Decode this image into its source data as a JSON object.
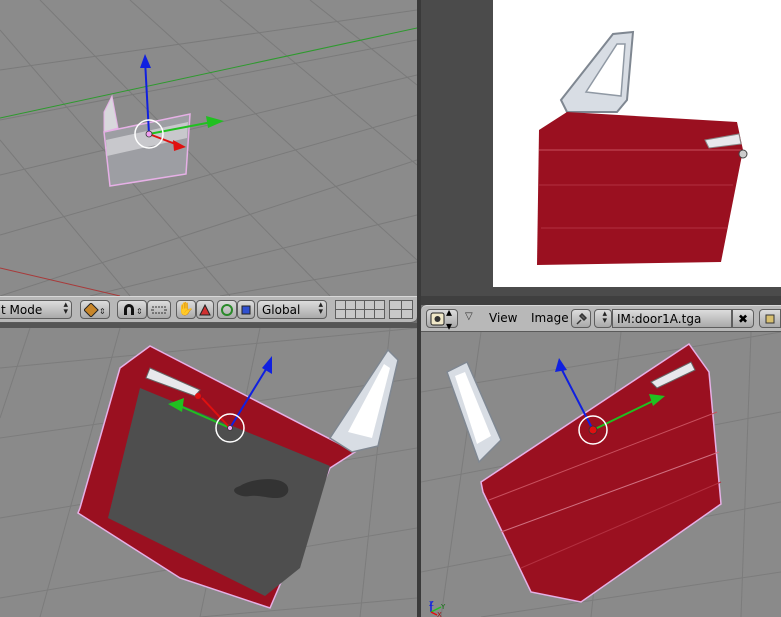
{
  "left_header": {
    "mode_label": "t Mode",
    "orientation_label": "Global"
  },
  "image_header": {
    "menu_view": "View",
    "menu_image": "Image",
    "image_name": "IM:door1A.tga",
    "close_symbol": "✖"
  },
  "axis_labels": {
    "z": "Z",
    "y": "Y",
    "x": "X"
  },
  "colors": {
    "door_red": "#9a1020",
    "viewport_gray": "#8a8a8a",
    "header_gray": "#b8b8b8",
    "axis_x": "#e01010",
    "axis_y": "#20c020",
    "axis_z": "#1030e0"
  },
  "icons": {
    "editor_type": "image-editor-icon",
    "pin": "pin-icon",
    "close": "close-icon",
    "object": "object-icon",
    "snap": "magnet-icon",
    "hand": "hand-icon",
    "triangle": "triangle-icon",
    "circle": "circle-icon",
    "square": "square-icon",
    "layers": "layers-icon"
  }
}
